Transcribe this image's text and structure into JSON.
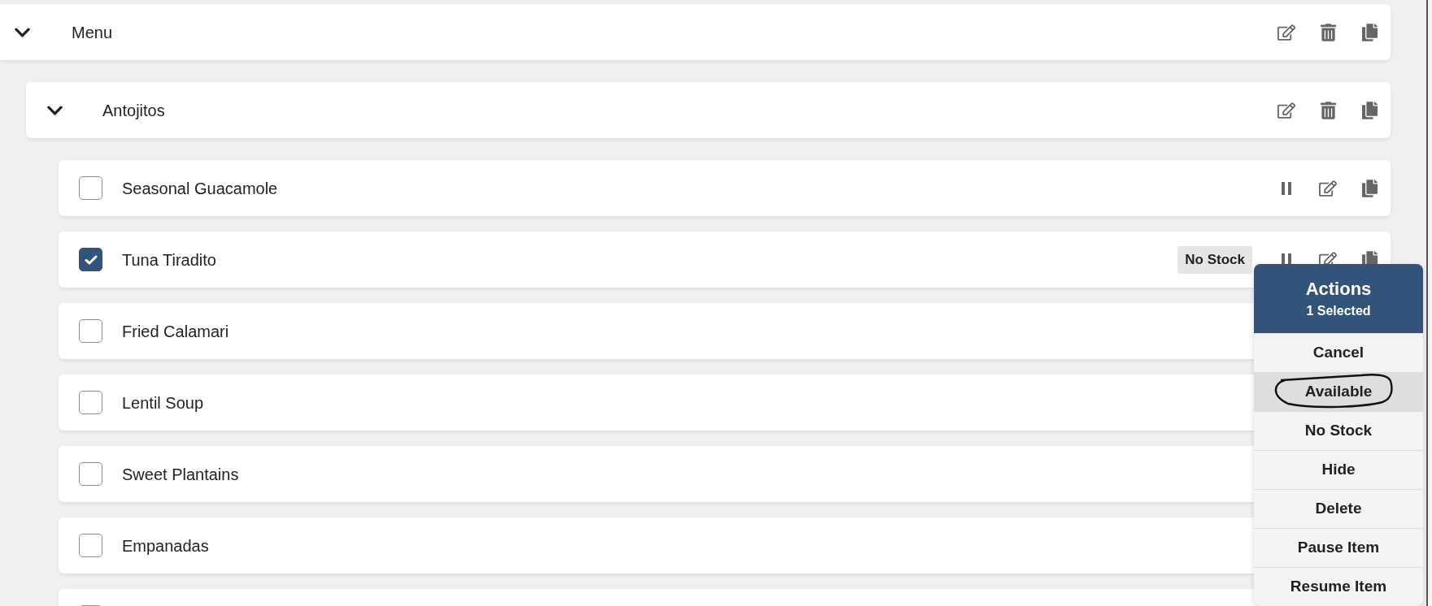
{
  "menu": {
    "title": "Menu",
    "expanded": true,
    "categories": [
      {
        "title": "Antojitos",
        "expanded": true,
        "items": [
          {
            "name": "Seasonal Guacamole",
            "checked": false
          },
          {
            "name": "Tuna Tiradito",
            "checked": true,
            "badge": "No Stock"
          },
          {
            "name": "Fried Calamari",
            "checked": false
          },
          {
            "name": "Lentil Soup",
            "checked": false
          },
          {
            "name": "Sweet Plantains",
            "checked": false
          },
          {
            "name": "Empanadas",
            "checked": false
          },
          {
            "checked": false
          }
        ]
      }
    ]
  },
  "actions_panel": {
    "title": "Actions",
    "subtitle": "1 Selected",
    "actions": [
      {
        "label": "Cancel",
        "highlighted": false,
        "circled": false
      },
      {
        "label": "Available",
        "highlighted": true,
        "circled": true
      },
      {
        "label": "No Stock",
        "highlighted": false,
        "circled": false
      },
      {
        "label": "Hide",
        "highlighted": false,
        "circled": false
      },
      {
        "label": "Delete",
        "highlighted": false,
        "circled": false
      },
      {
        "label": "Pause Item",
        "highlighted": false,
        "circled": false
      },
      {
        "label": "Resume Item",
        "highlighted": false,
        "circled": false
      }
    ]
  }
}
